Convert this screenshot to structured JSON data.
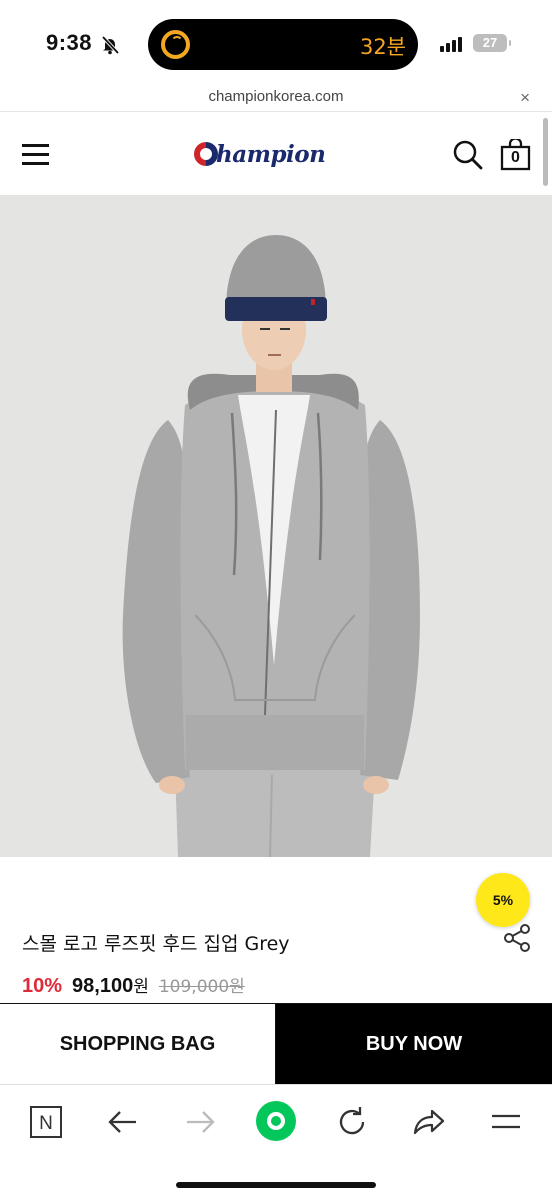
{
  "status_bar": {
    "time": "9:38",
    "island_text": "32분",
    "battery": "27"
  },
  "url_bar": {
    "url": "championkorea.com",
    "close_symbol": "×"
  },
  "header": {
    "logo_text": "Champion",
    "cart_count": "0"
  },
  "product": {
    "badge": "5%",
    "name": "스몰 로고 루즈핏 후드 집업 Grey",
    "discount_rate": "10%",
    "sale_price": "98,100",
    "currency": "원",
    "original_price": "109,000원"
  },
  "actions": {
    "shopping_bag": "SHOPPING BAG",
    "buy_now": "BUY NOW"
  },
  "toolbar": {
    "n_label": "N"
  },
  "colors": {
    "discount_red": "#e02a3a",
    "badge_yellow": "#ffe81a",
    "naver_green": "#03c75a",
    "logo_navy": "#1a2a6c",
    "logo_red": "#d0242b"
  }
}
